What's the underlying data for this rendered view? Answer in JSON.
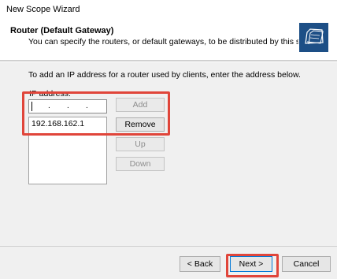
{
  "window": {
    "title": "New Scope Wizard"
  },
  "header": {
    "title": "Router (Default Gateway)",
    "subtitle": "You can specify the routers, or default gateways, to be distributed by this scope.",
    "icon": "folder-wizard-icon"
  },
  "instruction": "To add an IP address for a router used by clients, enter the address below.",
  "ip_label": "IP address:",
  "ip_input": {
    "value": "",
    "dots": [
      ".",
      ".",
      "."
    ]
  },
  "routers": [
    "192.168.162.1"
  ],
  "buttons": {
    "add": "Add",
    "remove": "Remove",
    "up": "Up",
    "down": "Down"
  },
  "footer": {
    "back": "< Back",
    "next": "Next >",
    "cancel": "Cancel"
  },
  "colors": {
    "highlight": "#e0453a",
    "icon_bg": "#1d4f86",
    "focus": "#0078d7"
  }
}
